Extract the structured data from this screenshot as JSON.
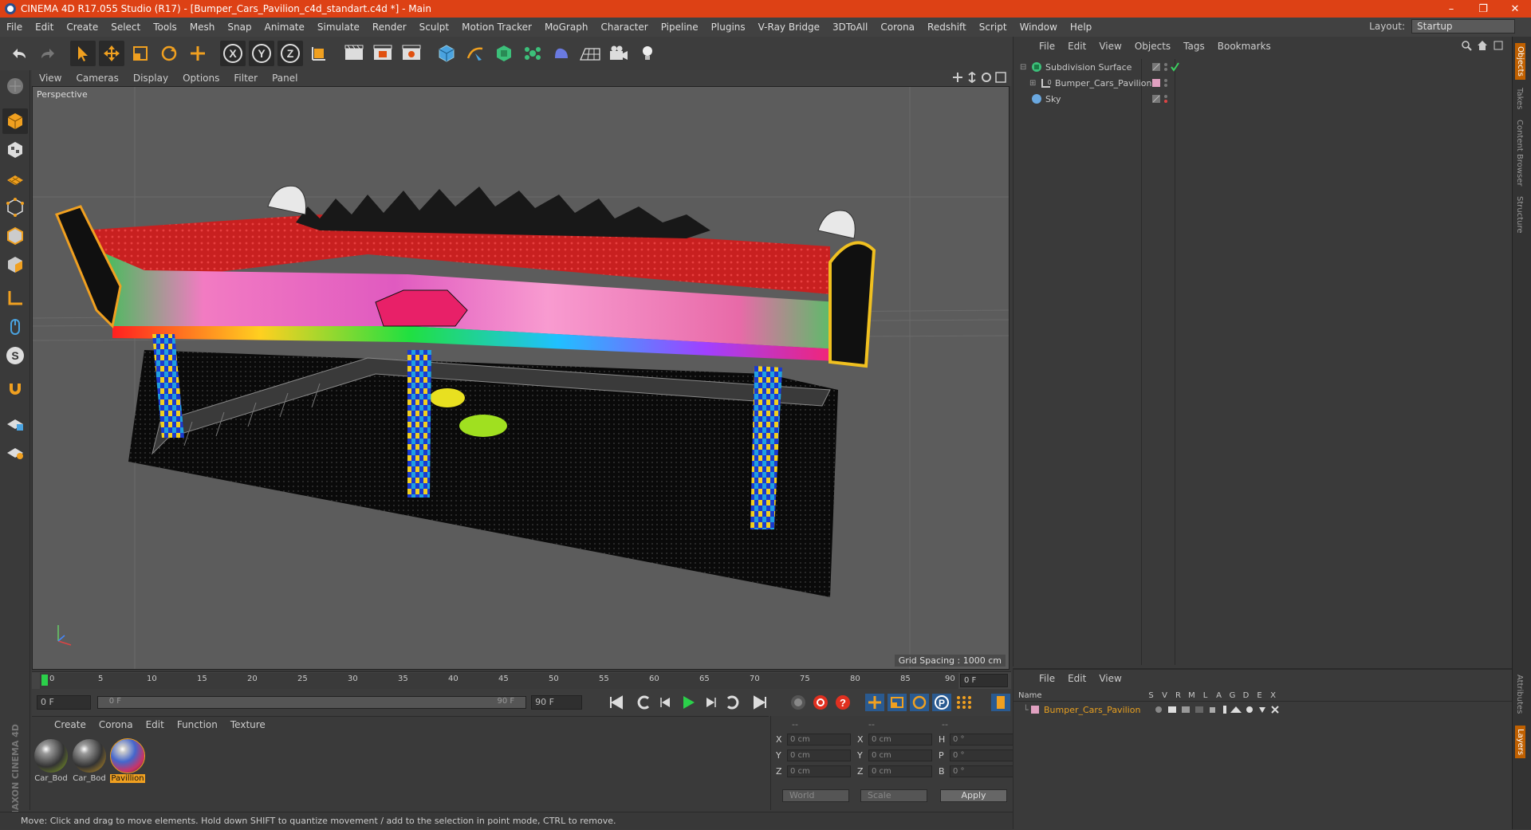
{
  "titlebar": {
    "title": "CINEMA 4D R17.055 Studio (R17) - [Bumper_Cars_Pavilion_c4d_standart.c4d *] - Main",
    "minimize": "–",
    "restore": "❐",
    "close": "✕"
  },
  "menubar": {
    "items": [
      "File",
      "Edit",
      "Create",
      "Select",
      "Tools",
      "Mesh",
      "Snap",
      "Animate",
      "Simulate",
      "Render",
      "Sculpt",
      "Motion Tracker",
      "MoGraph",
      "Character",
      "Pipeline",
      "Plugins",
      "V-Ray Bridge",
      "3DToAll",
      "Corona",
      "Redshift",
      "Script",
      "Window",
      "Help"
    ],
    "layout_label": "Layout:",
    "layout_value": "Startup"
  },
  "viewport": {
    "menu": [
      "View",
      "Cameras",
      "Display",
      "Options",
      "Filter",
      "Panel"
    ],
    "label": "Perspective",
    "grid_spacing": "Grid Spacing : 1000 cm"
  },
  "timeline": {
    "ticks": [
      "0",
      "5",
      "10",
      "15",
      "20",
      "25",
      "30",
      "35",
      "40",
      "45",
      "50",
      "55",
      "60",
      "65",
      "70",
      "75",
      "80",
      "85",
      "90"
    ],
    "current_frame": "0 F",
    "start_field": "0 F",
    "range_start": "0 F",
    "range_end": "90 F",
    "end_field": "90 F"
  },
  "materials": {
    "menu": [
      "Create",
      "Corona",
      "Edit",
      "Function",
      "Texture"
    ],
    "items": [
      {
        "name": "Car_Bod"
      },
      {
        "name": "Car_Bod"
      },
      {
        "name": "Pavillion"
      }
    ]
  },
  "coords": {
    "headers": [
      "--",
      "--",
      "--"
    ],
    "rows": [
      {
        "l1": "X",
        "v1": "0 cm",
        "l2": "X",
        "v2": "0 cm",
        "l3": "H",
        "v3": "0 °"
      },
      {
        "l1": "Y",
        "v1": "0 cm",
        "l2": "Y",
        "v2": "0 cm",
        "l3": "P",
        "v3": "0 °"
      },
      {
        "l1": "Z",
        "v1": "0 cm",
        "l2": "Z",
        "v2": "0 cm",
        "l3": "B",
        "v3": "0 °"
      }
    ],
    "world": "World",
    "scale": "Scale",
    "apply": "Apply"
  },
  "status": "Move: Click and drag to move elements. Hold down SHIFT to quantize movement / add to the selection in point mode, CTRL to remove.",
  "objects": {
    "menu": [
      "File",
      "Edit",
      "View",
      "Objects",
      "Tags",
      "Bookmarks"
    ],
    "items": [
      {
        "name": "Subdivision Surface"
      },
      {
        "name": "Bumper_Cars_Pavilion"
      },
      {
        "name": "Sky"
      }
    ]
  },
  "layers": {
    "menu": [
      "File",
      "Edit",
      "View"
    ],
    "name_header": "Name",
    "cols": [
      "S",
      "V",
      "R",
      "M",
      "L",
      "A",
      "G",
      "D",
      "E",
      "X"
    ],
    "item": "Bumper_Cars_Pavilion"
  },
  "right_tabs": [
    "Objects",
    "Takes",
    "Content Browser",
    "Structure",
    "Attributes",
    "Layers"
  ],
  "brand": "MAXON CINEMA 4D",
  "colors": {
    "title_bg": "#dd4115",
    "accent_orange": "#f0a020",
    "layer_name": "#e8a020"
  }
}
